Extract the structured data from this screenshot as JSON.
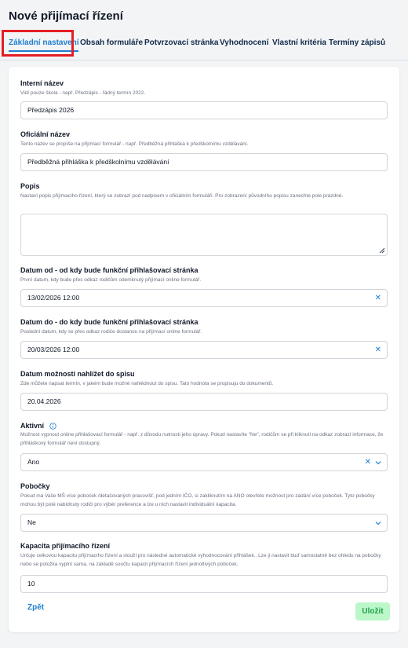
{
  "page": {
    "title": "Nové přijímací řízení"
  },
  "tabs": [
    {
      "label": "Základní nastavení",
      "active": true
    },
    {
      "label": "Obsah formuláře"
    },
    {
      "label": "Potvrzovací stránka"
    },
    {
      "label": "Vyhodnocení"
    },
    {
      "label": "Vlastní kritéria"
    },
    {
      "label": "Termíny zápisů"
    }
  ],
  "form": {
    "internal_name": {
      "label": "Interní název",
      "help": "Vidí pouze škola - např. Předzápis - řádný termín 2022.",
      "value": "Předzápis 2026"
    },
    "official_name": {
      "label": "Oficiální název",
      "help": "Tento název se propíše na přijímací formulář - např. Předběžná přihláška k předškolnímu vzdělávání.",
      "value": "Předběžná přihláška k předškolnímu vzdělávání"
    },
    "description": {
      "label": "Popis",
      "help": "Nastaví popis přijímacího řízení, který se zobrazí pod nadpisem v oficiálním formuláři. Pro zobrazení původního popisu zanechte pole prázdné.",
      "value": ""
    },
    "date_from": {
      "label": "Datum od - od kdy bude funkční přihlašovací stránka",
      "help": "První datum, kdy bude přes odkaz rodičům odemknutý přijímací online formulář.",
      "value": "13/02/2026 12:00"
    },
    "date_to": {
      "label": "Datum do - do kdy bude funkční přihlašovací stránka",
      "help": "Poslední datum, kdy se přes odkaz rodiče dostanou na přijímací online formulář.",
      "value": "20/03/2026 12:00"
    },
    "file_date": {
      "label": "Datum možnosti nahlížet do spisu",
      "help": "Zde můžete napsat termín, v jakém bude možné nahlédnout do spisu. Tato hodnota se propisuju do dokumentů.",
      "value": "20.04.2026"
    },
    "active": {
      "label": "Aktivní",
      "help": "Možnost vypnout online přihlašovací formulář - např. z důvodu nutnosti jeho úpravy. Pokud nastavíte \"Ne\", rodičům se při kliknutí na odkaz zobrazí informace, že přihláškový formulář není dostupný.",
      "value": "Ano"
    },
    "branches": {
      "label": "Pobočky",
      "help": "Pokud má Vaše MŠ více poboček /detašovaných pracovišť, pod jedním IČO, si zakliknutím na ANO otevřete možnost pro zadání více poboček. Tyto pobočky mohou být poté nabídnuty rodiči pro výběr preference a lze u nich nastavit individuální kapacita.",
      "value": "Ne"
    },
    "capacity": {
      "label": "Kapacita přijímacího řízení",
      "help": "Určuje celkovou kapacitu přijímacího řízení a slouží pro následné automatické vyhodnocování přihlášek.. Lze ji nastavit buď samostatně bez ohledu na pobočky nebo se položka vyplní sama, na základě součtu kapacit přijímacích řízení jednotlivých poboček.",
      "value": "10"
    }
  },
  "buttons": {
    "back": "Zpět",
    "save": "Uložit"
  },
  "colors": {
    "accent": "#1d7fd1",
    "highlight": "#e31e24",
    "save_bg": "#bbf7c8",
    "save_text": "#22a04b"
  },
  "icons": {
    "clear": "close-icon",
    "dropdown": "chevron-down-icon",
    "info": "info-icon",
    "resize": "resize-grip-icon"
  }
}
